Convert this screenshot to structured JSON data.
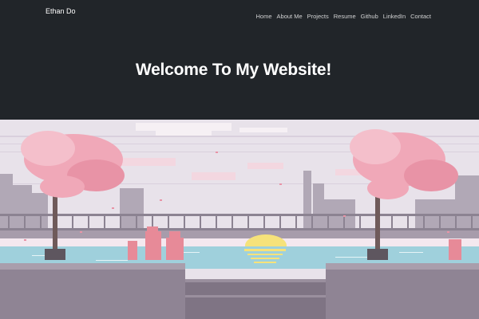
{
  "navbar": {
    "brand": "Ethan Do",
    "links": [
      {
        "label": "Home"
      },
      {
        "label": "About Me"
      },
      {
        "label": "Projects"
      },
      {
        "label": "Resume"
      },
      {
        "label": "Github"
      },
      {
        "label": "LinkedIn"
      },
      {
        "label": "Contact"
      }
    ]
  },
  "hero": {
    "title": "Welcome To My Website!"
  },
  "banner": {
    "scene": "pixel-art-cherry-blossom-waterfront",
    "colors": {
      "sky": "#e8e2ea",
      "blossom": "#f0a8b8",
      "water": "#9fd0dc",
      "sun": "#f6e27a",
      "ground": "#8f8494"
    }
  }
}
